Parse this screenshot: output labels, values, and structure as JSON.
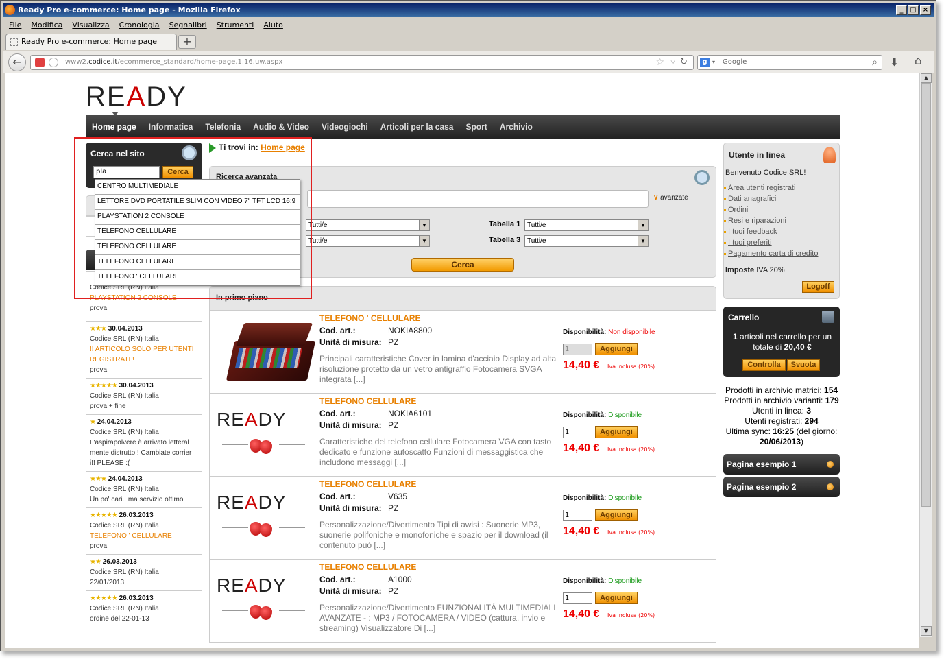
{
  "window": {
    "title": "Ready Pro e-commerce: Home page - Mozilla Firefox"
  },
  "menu": [
    "File",
    "Modifica",
    "Visualizza",
    "Cronologia",
    "Segnalibri",
    "Strumenti",
    "Aiuto"
  ],
  "tab": {
    "title": "Ready Pro e-commerce: Home page",
    "new_tab": "+"
  },
  "address": {
    "host": "www2.codice.it",
    "path": "/ecommerce_standard/home-page.1.16.uw.aspx",
    "domain_text": "codice.it",
    "prefix": "www2.",
    "suffix": "/ecommerce_standard/home-page.1.16.uw.aspx"
  },
  "search_engine": {
    "placeholder": "Google",
    "icon": "google-icon"
  },
  "site": {
    "logo_left": "RE",
    "logo_accent": "A",
    "logo_right": "DY",
    "nav": [
      "Home page",
      "Informatica",
      "Telefonia",
      "Audio & Video",
      "Videogiochi",
      "Articoli per la casa",
      "Sport",
      "Archivio"
    ]
  },
  "search": {
    "title": "Cerca nel sito",
    "value": "pla",
    "button": "Cerca",
    "suggestions": [
      "CENTRO MULTIMEDIALE",
      "LETTORE DVD PORTATILE SLIM CON VIDEO 7\" TFT LCD 16:9",
      "PLAYSTATION 2 CONSOLE",
      "TELEFONO CELLULARE",
      "TELEFONO CELLULARE",
      "TELEFONO CELLULARE",
      "TELEFONO ' CELLULARE"
    ]
  },
  "breadcrumb": {
    "label": "Ti trovi in:",
    "link": "Home page"
  },
  "advanced": {
    "title": "Ricerca avanzata",
    "more": "avanzate",
    "table1_label": "Tabella 1",
    "table3_label": "Tabella 3",
    "select_value": "Tutti/e",
    "button": "Cerca"
  },
  "featured": {
    "title": "In primo piano"
  },
  "labels": {
    "code": "Cod. art.:",
    "unit": "Unità di misura:",
    "availability": "Disponibilità:",
    "add": "Aggiungi",
    "vat": "Iva inclusa (20%)"
  },
  "products": [
    {
      "name": "TELEFONO ' CELLULARE",
      "code": "NOKIA8800",
      "unit": "PZ",
      "availability": "Non disponibile",
      "qty": "1",
      "price": "14,40 €",
      "desc": "Principali caratteristiche Cover in lamina d'acciaio Display ad alta risoluzione protetto da un vetro antigraffio Fotocamera SVGA integrata [...]"
    },
    {
      "name": "TELEFONO CELLULARE",
      "code": "NOKIA6101",
      "unit": "PZ",
      "availability": "Disponibile",
      "qty": "1",
      "price": "14,40 €",
      "desc": "Caratteristiche del telefono cellulare Fotocamera VGA con tasto dedicato e funzione autoscatto Funzioni di messaggistica che includono messaggi [...]"
    },
    {
      "name": "TELEFONO CELLULARE",
      "code": "V635",
      "unit": "PZ",
      "availability": "Disponibile",
      "qty": "1",
      "price": "14,40 €",
      "desc": "Personalizzazione/Divertimento Tipi di awisi : Suonerie MP3, suonerie polifoniche e monofoniche e spazio per il download (il contenuto può [...]"
    },
    {
      "name": "TELEFONO CELLULARE",
      "code": "A1000",
      "unit": "PZ",
      "availability": "Disponibile",
      "qty": "1",
      "price": "14,40 €",
      "desc": "Personalizzazione/Divertimento FUNZIONALITÀ MULTIMEDIALI AVANZATE - : MP3 / FOTOCAMERA / VIDEO (cattura, invio e streaming) Visualizzatore Di [...]"
    }
  ],
  "reviews": [
    {
      "date": "",
      "stars": "★",
      "author": "Codice SRL (RN) Italia",
      "item": "PLAYSTATION 2 CONSOLE",
      "text": "prova"
    },
    {
      "date": "30.04.2013",
      "stars": "★★★",
      "author": "Codice SRL (RN) Italia",
      "item": "!! ARTICOLO SOLO PER UTENTI REGISTRATI !",
      "text": "prova"
    },
    {
      "date": "30.04.2013",
      "stars": "★★★★★",
      "author": "Codice SRL (RN) Italia",
      "item": "",
      "text": "prova + fine"
    },
    {
      "date": "24.04.2013",
      "stars": "★",
      "author": "Codice SRL (RN) Italia",
      "item": "",
      "text": "L'aspirapolvere è arrivato letteral mente distrutto!! Cambiate corrier i!! PLEASE :("
    },
    {
      "date": "24.04.2013",
      "stars": "★★★",
      "author": "Codice SRL (RN) Italia",
      "item": "",
      "text": "Un po' cari.. ma servizio ottimo"
    },
    {
      "date": "26.03.2013",
      "stars": "★★★★★",
      "author": "Codice SRL (RN) Italia",
      "item": "TELEFONO ' CELLULARE",
      "text": "prova"
    },
    {
      "date": "26.03.2013",
      "stars": "★★",
      "author": "Codice SRL (RN) Italia",
      "item": "",
      "text": "22/01/2013"
    },
    {
      "date": "26.03.2013",
      "stars": "★★★★★",
      "author": "Codice SRL (RN) Italia",
      "item": "",
      "text": "ordine del 22-01-13"
    }
  ],
  "user": {
    "title": "Utente in linea",
    "welcome": "Benvenuto Codice SRL!",
    "links": [
      "Area utenti registrati",
      "Dati anagrafici",
      "Ordini",
      "Resi e riparazioni",
      "I tuoi feedback",
      "I tuoi preferiti",
      "Pagamento carta di credito"
    ],
    "tax_label": "Imposte",
    "tax_value": "IVA 20%",
    "logoff": "Logoff"
  },
  "cart": {
    "title": "Carrello",
    "count": "1",
    "text1": "articoli nel carrello per un totale di",
    "total": "20,40 €",
    "check": "Controlla",
    "empty": "Svuota"
  },
  "stats": {
    "l1": "Prodotti in archivio matrici:",
    "v1": "154",
    "l2": "Prodotti in archivio varianti:",
    "v2": "179",
    "l3": "Utenti in linea:",
    "v3": "3",
    "l4": "Utenti registrati:",
    "v4": "294",
    "l5": "Ultima sync:",
    "v5": "16:25",
    "l5b": "(del giorno:",
    "v5b": "20/06/2013",
    "l5c": ")"
  },
  "pages": [
    "Pagina esempio 1",
    "Pagina esempio 2"
  ]
}
